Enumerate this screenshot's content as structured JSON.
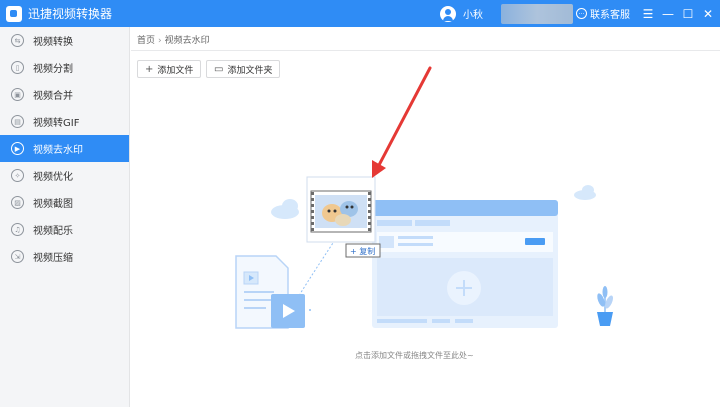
{
  "app": {
    "title": "迅捷视频转换器"
  },
  "user": {
    "name": "小秋"
  },
  "header": {
    "support_label": "联系客服"
  },
  "window_controls": {
    "menu": "☰",
    "minimize": "—",
    "maximize": "☐",
    "close": "✕"
  },
  "sidebar": {
    "items": [
      {
        "label": "视频转换",
        "icon": "convert-icon",
        "glyph": "⇆"
      },
      {
        "label": "视频分割",
        "icon": "split-icon",
        "glyph": "▯"
      },
      {
        "label": "视频合并",
        "icon": "merge-icon",
        "glyph": "▣"
      },
      {
        "label": "视频转GIF",
        "icon": "gif-icon",
        "glyph": "▤"
      },
      {
        "label": "视频去水印",
        "icon": "play-icon",
        "glyph": "▶",
        "active": true
      },
      {
        "label": "视频优化",
        "icon": "optimize-icon",
        "glyph": "✧"
      },
      {
        "label": "视频截图",
        "icon": "screenshot-icon",
        "glyph": "▨"
      },
      {
        "label": "视频配乐",
        "icon": "music-icon",
        "glyph": "♫"
      },
      {
        "label": "视频压缩",
        "icon": "compress-icon",
        "glyph": "⇲"
      }
    ]
  },
  "breadcrumb": {
    "home": "首页",
    "current": "视频去水印"
  },
  "toolbar": {
    "add_file": "添加文件",
    "add_folder": "添加文件夹"
  },
  "dropzone": {
    "copy_badge": "+ 复制",
    "hint": "点击添加文件或拖拽文件至此处~"
  },
  "colors": {
    "accent": "#2f8cf5",
    "arrow": "#e53935"
  }
}
